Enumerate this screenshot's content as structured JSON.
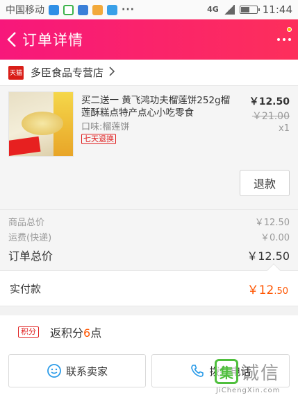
{
  "status_bar": {
    "carrier": "中国移动",
    "dots": "···",
    "network": "4G",
    "time": "11:44"
  },
  "header": {
    "title": "订单详情"
  },
  "store": {
    "badge": "天猫",
    "name": "多臣食品专营店"
  },
  "product": {
    "title": "买二送一 黄飞鸿功夫榴莲饼252g榴莲酥糕点特产点心小吃零食",
    "attribute": "口味:榴莲饼",
    "tag": "七天退换",
    "price": "￥12.50",
    "original_price": "￥21.00",
    "quantity": "x1",
    "refund_label": "退款"
  },
  "summary": {
    "goods_label": "商品总价",
    "goods_value": "￥12.50",
    "shipping_label": "运费(快递)",
    "shipping_value": "￥0.00",
    "total_label": "订单总价",
    "total_value": "￥12.50"
  },
  "payment": {
    "label": "实付款",
    "value_main": "￥12",
    "value_decimal": ".50"
  },
  "points": {
    "tag": "积分",
    "text_prefix": "返积分",
    "number": "6",
    "text_suffix": "点"
  },
  "actions": {
    "contact_label": "联系卖家",
    "call_label": "拨打电话"
  },
  "watermark": {
    "logo": "集",
    "text": "诚信",
    "url": "JiChengXin.com"
  },
  "colors": {
    "header_start": "#f7177b",
    "header_end": "#fd2f5b",
    "accent_orange": "#ff5500",
    "tag_red": "#e02020"
  }
}
